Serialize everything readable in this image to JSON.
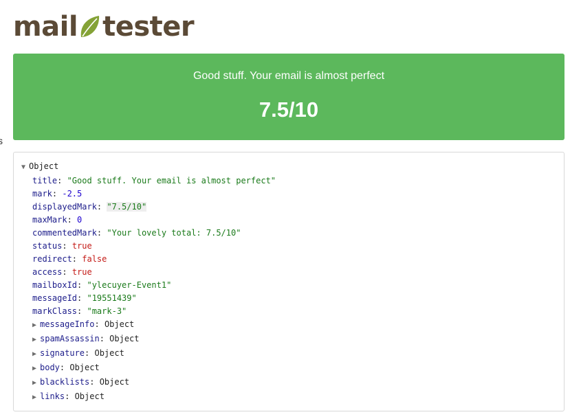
{
  "brand": {
    "part1": "mail",
    "part2": "tester",
    "accent": "#84a236",
    "text_color": "#5b4a36"
  },
  "edge_glyph": "s",
  "banner": {
    "message": "Good stuff. Your email is almost perfect",
    "score": "7.5/10",
    "color": "#5cb85c"
  },
  "inspector": {
    "root_label": "Object",
    "props": [
      {
        "key": "title",
        "value": "\"Good stuff. Your email is almost perfect\"",
        "kind": "str"
      },
      {
        "key": "mark",
        "value": "-2.5",
        "kind": "num"
      },
      {
        "key": "displayedMark",
        "value": "\"7.5/10\"",
        "kind": "str"
      },
      {
        "key": "maxMark",
        "value": "0",
        "kind": "num"
      },
      {
        "key": "commentedMark",
        "value": "\"Your lovely total: 7.5/10\"",
        "kind": "str"
      },
      {
        "key": "status",
        "value": "true",
        "kind": "bool"
      },
      {
        "key": "redirect",
        "value": "false",
        "kind": "bool"
      },
      {
        "key": "access",
        "value": "true",
        "kind": "bool"
      },
      {
        "key": "mailboxId",
        "value": "\"ylecuyer-Event1\"",
        "kind": "str"
      },
      {
        "key": "messageId",
        "value": "\"19551439\"",
        "kind": "str"
      },
      {
        "key": "markClass",
        "value": "\"mark-3\"",
        "kind": "str"
      }
    ],
    "children": [
      {
        "key": "messageInfo",
        "value": "Object"
      },
      {
        "key": "spamAssassin",
        "value": "Object"
      },
      {
        "key": "signature",
        "value": "Object"
      },
      {
        "key": "body",
        "value": "Object"
      },
      {
        "key": "blacklists",
        "value": "Object"
      },
      {
        "key": "links",
        "value": "Object"
      }
    ]
  }
}
